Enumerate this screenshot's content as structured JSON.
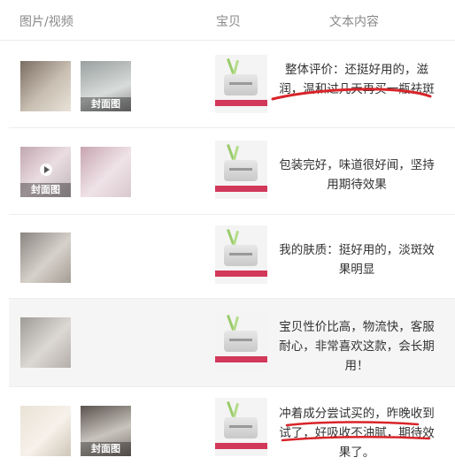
{
  "header": {
    "media": "图片/视频",
    "item": "宝贝",
    "text": "文本内容"
  },
  "cover_label": "封面图",
  "reviews": [
    {
      "text": "整体评价：还挺好用的，滋润，温和过几天再买一瓶祛斑"
    },
    {
      "text": "包装完好，味道很好闻，坚持用期待效果"
    },
    {
      "text": "我的肤质：挺好用的，淡斑效果明显"
    },
    {
      "text": "宝贝性价比高，物流快，客服耐心，非常喜欢这款，会长期用！"
    },
    {
      "text": "冲着成分尝试买的，昨晚收到试了，好吸收不油腻，期待效果了。"
    }
  ],
  "colors": {
    "annotation": "#d8242a",
    "stripe": "#d2385a"
  }
}
